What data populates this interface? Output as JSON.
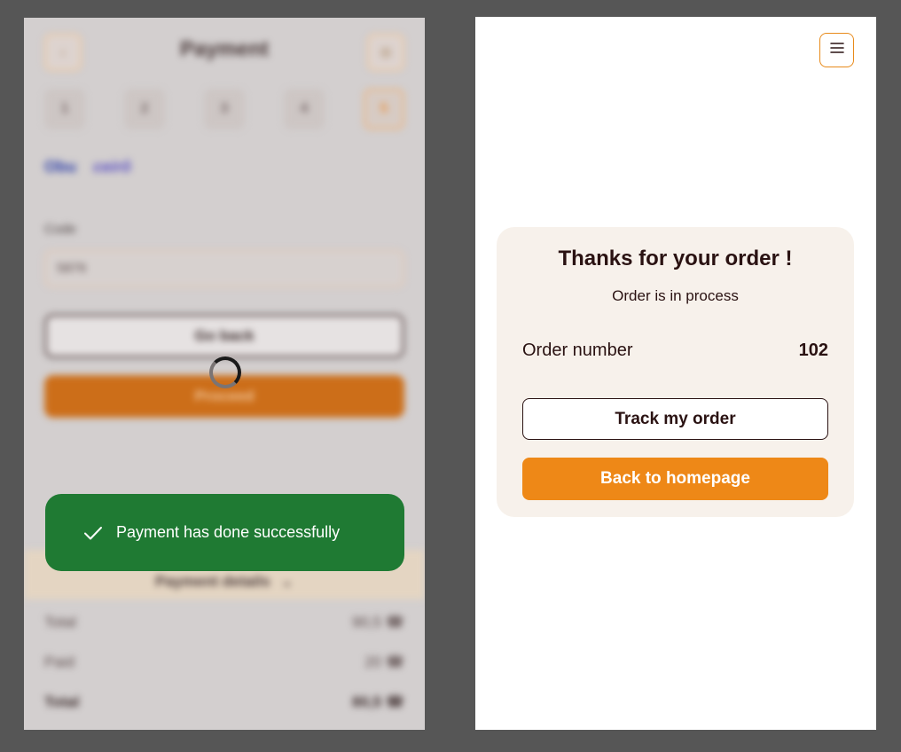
{
  "payment_screen": {
    "title": "Payment",
    "back_icon": "chevron-left-icon",
    "info_icon": "info-icon",
    "steps": [
      "1",
      "2",
      "3",
      "4",
      "5"
    ],
    "card_logos": [
      "Obu",
      "ceirô"
    ],
    "code_label": "Code",
    "code_value": "5876",
    "go_back_label": "Go back",
    "proceed_label": "Proceed",
    "details_label": "Payment details",
    "summary": [
      {
        "label": "Total",
        "value": "90,5 ☎"
      },
      {
        "label": "Paid",
        "value": "20 ☎"
      },
      {
        "label": "Total",
        "value": "80,5 ☎"
      }
    ]
  },
  "toast": {
    "icon": "check-icon",
    "message": "Payment has done successfully",
    "color": "#1f7a33"
  },
  "confirmation": {
    "menu_icon": "menu-icon",
    "title": "Thanks for your order !",
    "status": "Order is in process",
    "order_number_label": "Order number",
    "order_number": "102",
    "track_label": "Track my order",
    "home_label": "Back to homepage",
    "accent_color": "#ee8817"
  }
}
